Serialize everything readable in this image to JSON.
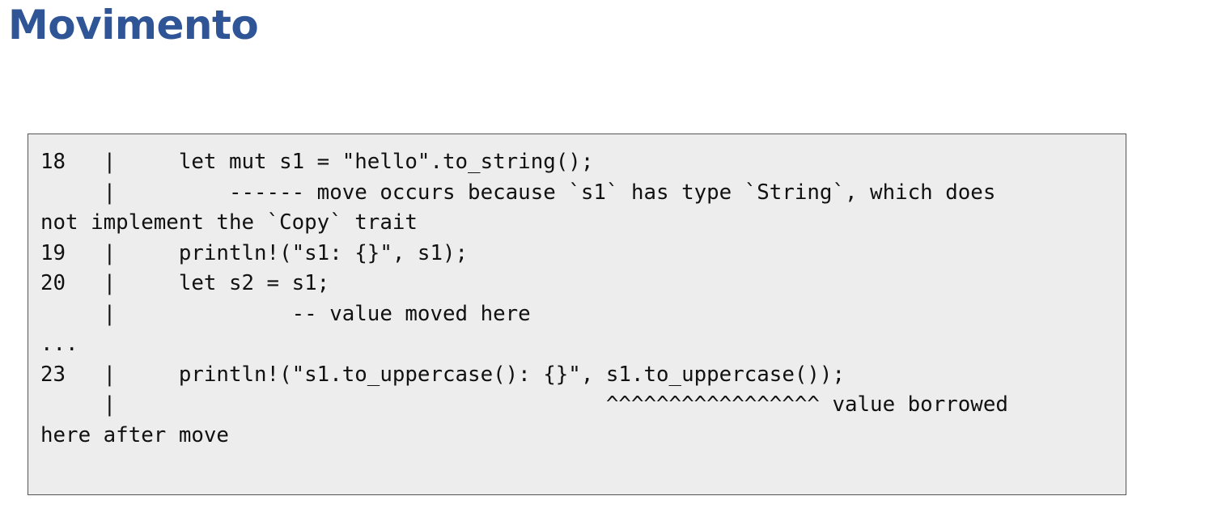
{
  "slide": {
    "title": "Movimento"
  },
  "code_block": {
    "lines": [
      "18   |     let mut s1 = \"hello\".to_string();",
      "     |         ------ move occurs because `s1` has type `String`, which does",
      "not implement the `Copy` trait",
      "19   |     println!(\"s1: {}\", s1);",
      "20   |     let s2 = s1;",
      "     |              -- value moved here",
      "...",
      "23   |     println!(\"s1.to_uppercase(): {}\", s1.to_uppercase());",
      "     |                                       ^^^^^^^^^^^^^^^^^ value borrowed",
      "here after move"
    ]
  }
}
